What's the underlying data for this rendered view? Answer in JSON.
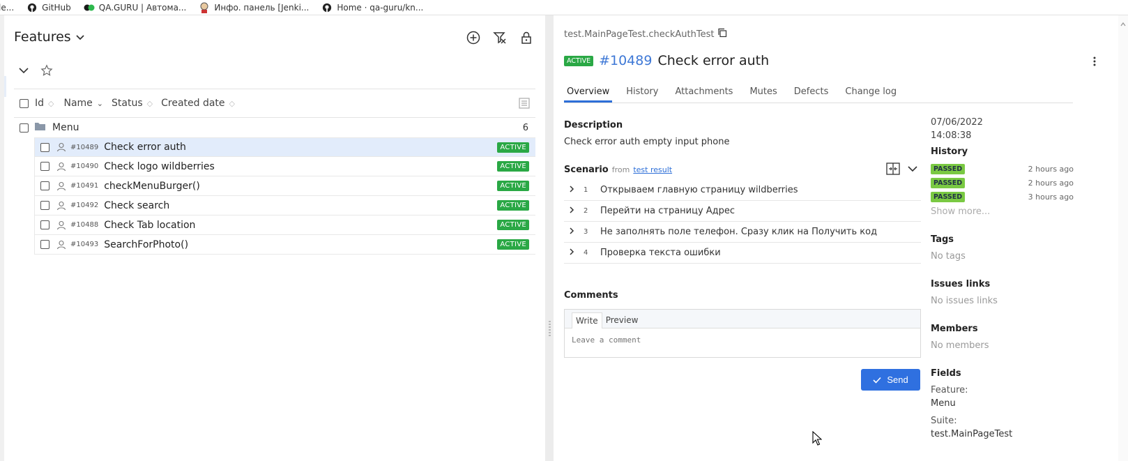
{
  "bookmarks": [
    {
      "label": "le...",
      "icon": "none"
    },
    {
      "label": "GitHub",
      "icon": "github-icon"
    },
    {
      "label": "QA.GURU | Автома...",
      "icon": "qaguru-icon"
    },
    {
      "label": "Инфо. панель [Jenki...",
      "icon": "jenkins-icon"
    },
    {
      "label": "Home · qa-guru/kn...",
      "icon": "github-icon"
    }
  ],
  "left": {
    "title": "Features",
    "columns": {
      "id": "Id",
      "name": "Name",
      "status": "Status",
      "created": "Created date"
    },
    "group": {
      "name": "Menu",
      "count": "6"
    },
    "rows": [
      {
        "id": "#10489",
        "name": "Check error auth",
        "status": "ACTIVE"
      },
      {
        "id": "#10490",
        "name": "Check logo wildberries",
        "status": "ACTIVE"
      },
      {
        "id": "#10491",
        "name": "checkMenuBurger()",
        "status": "ACTIVE"
      },
      {
        "id": "#10492",
        "name": "Check search",
        "status": "ACTIVE"
      },
      {
        "id": "#10488",
        "name": "Check Tab location",
        "status": "ACTIVE"
      },
      {
        "id": "#10493",
        "name": "SearchForPhoto()",
        "status": "ACTIVE"
      }
    ]
  },
  "right": {
    "path": "test.MainPageTest.checkAuthTest",
    "status_badge": "ACTIVE",
    "test_id": "#10489",
    "test_name": "Check error auth",
    "tabs": [
      "Overview",
      "History",
      "Attachments",
      "Mutes",
      "Defects",
      "Change log"
    ],
    "description_heading": "Description",
    "description_text": "Check error auth empty input phone",
    "scenario_heading": "Scenario",
    "scenario_from": "from",
    "scenario_link": "test result",
    "steps": [
      {
        "num": "1",
        "text": "Открываем главную страницу wildberries"
      },
      {
        "num": "2",
        "text": "Перейти на страницу Адрес"
      },
      {
        "num": "3",
        "text": "Не заполнять поле телефон. Сразу клик на Получить код"
      },
      {
        "num": "4",
        "text": "Проверка текста ошибки"
      }
    ],
    "comments_heading": "Comments",
    "comment_tab_write": "Write",
    "comment_tab_preview": "Preview",
    "comment_placeholder": "Leave a comment",
    "send_label": "Send",
    "side": {
      "date": "07/06/2022",
      "time": "14:08:38",
      "history_heading": "History",
      "history": [
        {
          "status": "PASSED",
          "time": "2 hours ago"
        },
        {
          "status": "PASSED",
          "time": "2 hours ago"
        },
        {
          "status": "PASSED",
          "time": "3 hours ago"
        }
      ],
      "show_more": "Show more...",
      "tags_heading": "Tags",
      "tags_empty": "No tags",
      "issues_heading": "Issues links",
      "issues_empty": "No issues links",
      "members_heading": "Members",
      "members_empty": "No members",
      "fields_heading": "Fields",
      "feature_label": "Feature:",
      "feature_value": "Menu",
      "suite_label": "Suite:",
      "suite_value": "test.MainPageTest"
    }
  },
  "colors": {
    "active_badge": "#2aa845",
    "passed_badge": "#7ac943",
    "accent": "#2f70e0",
    "selected_row": "#e2ecfb"
  }
}
